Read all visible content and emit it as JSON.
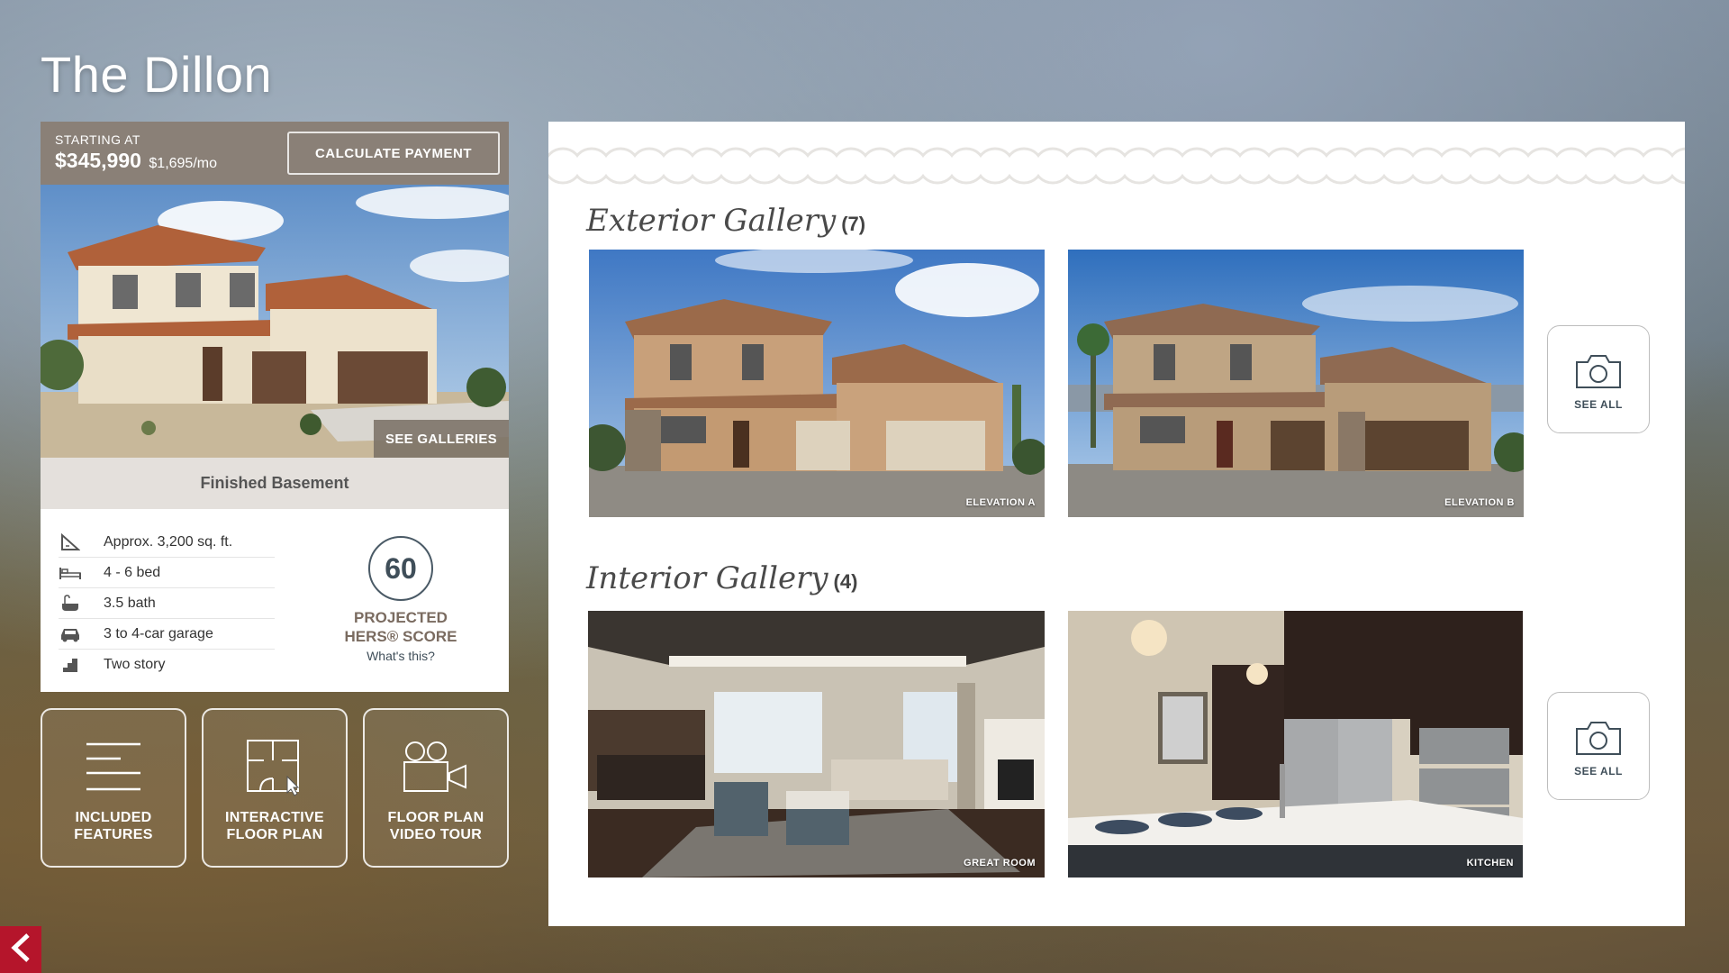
{
  "page": {
    "title": "The Dillon"
  },
  "pricing": {
    "label": "STARTING AT",
    "price": "$345,990",
    "monthly": "$1,695/mo",
    "calculate_label": "CALCULATE PAYMENT"
  },
  "hero": {
    "see_galleries_label": "SEE GALLERIES"
  },
  "variant": "Finished Basement",
  "specs": [
    {
      "icon": "square-footage-icon",
      "label": "Approx. 3,200 sq. ft."
    },
    {
      "icon": "bed-icon",
      "label": "4 - 6 bed"
    },
    {
      "icon": "bath-icon",
      "label": "3.5 bath"
    },
    {
      "icon": "car-icon",
      "label": "3 to 4-car garage"
    },
    {
      "icon": "stairs-icon",
      "label": "Two story"
    }
  ],
  "hers": {
    "score": "60",
    "label_line1": "PROJECTED",
    "label_line2": "HERS® SCORE",
    "link": "What's this?"
  },
  "tiles": [
    {
      "icon": "list-icon",
      "line1": "INCLUDED",
      "line2": "FEATURES"
    },
    {
      "icon": "floor-plan-icon",
      "line1": "INTERACTIVE",
      "line2": "FLOOR PLAN"
    },
    {
      "icon": "video-camera-icon",
      "line1": "FLOOR PLAN",
      "line2": "VIDEO TOUR"
    }
  ],
  "exterior": {
    "title": "Exterior Gallery",
    "count": "(7)",
    "images": [
      {
        "caption": "ELEVATION A"
      },
      {
        "caption": "ELEVATION B"
      }
    ],
    "see_all_label": "SEE ALL"
  },
  "interior": {
    "title": "Interior Gallery",
    "count": "(4)",
    "images": [
      {
        "caption": "GREAT ROOM"
      },
      {
        "caption": "KITCHEN"
      }
    ],
    "see_all_label": "SEE ALL"
  },
  "colors": {
    "price_bar": "#8a8077",
    "accent_red": "#b5152b",
    "text_dark": "#3f4e59"
  }
}
